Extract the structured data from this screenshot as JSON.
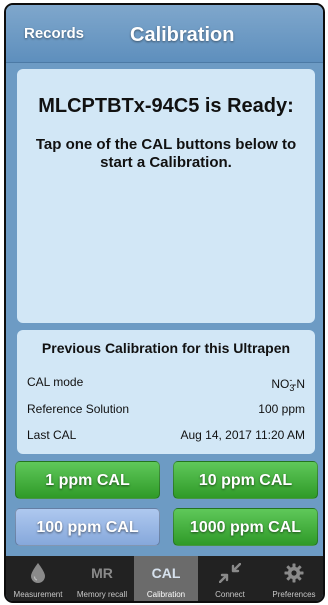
{
  "header": {
    "records_link": "Records",
    "title": "Calibration"
  },
  "status": {
    "title": "MLCPTBTx-94C5 is Ready:",
    "subtitle": "Tap one of the CAL buttons below to start a Calibration."
  },
  "previous_calibration": {
    "title": "Previous Calibration for this Ultrapen",
    "rows": [
      {
        "label": "CAL mode",
        "value": {
          "formula": "NO",
          "subscript": "3",
          "superscript": "-",
          "suffix": "-N"
        }
      },
      {
        "label": "Reference Solution",
        "value": "100 ppm"
      },
      {
        "label": "Last CAL",
        "value": "Aug 14, 2017 11:20 AM"
      }
    ]
  },
  "cal_buttons": [
    {
      "label": "1 ppm CAL",
      "color": "#3aa833"
    },
    {
      "label": "10 ppm CAL",
      "color": "#3aa833"
    },
    {
      "label": "100 ppm CAL",
      "color": "#96b5e4"
    },
    {
      "label": "1000 ppm CAL",
      "color": "#3aa833"
    }
  ],
  "tabbar": {
    "active": "calibration",
    "tabs": [
      {
        "label": "Measurement",
        "icon": "drop-icon",
        "glyph": ""
      },
      {
        "label": "Memory recall",
        "icon": "mr-text-icon",
        "glyph": "MR"
      },
      {
        "label": "Calibration",
        "icon": "cal-text-icon",
        "glyph": "CAL"
      },
      {
        "label": "Connect",
        "icon": "connect-arrows-icon",
        "glyph": ""
      },
      {
        "label": "Preferences",
        "icon": "gear-icon",
        "glyph": ""
      }
    ]
  },
  "colors": {
    "header": "#6d9bc4",
    "card": "#d2e7f6",
    "green_button": "#3aa833",
    "blue_button": "#96b5e4",
    "tabbar": "#222222",
    "active_tab": "#6b6b6b"
  }
}
